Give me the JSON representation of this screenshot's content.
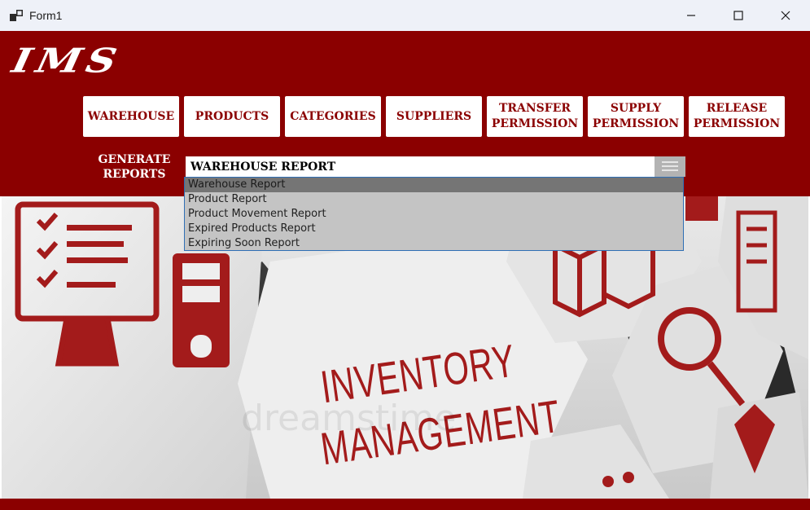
{
  "window": {
    "title": "Form1"
  },
  "app": {
    "logo": "IMS"
  },
  "nav": {
    "warehouse": "WAREHOUSE",
    "products": "PRODUCTS",
    "categories": "CATEGORIES",
    "suppliers": "SUPPLIERS",
    "transfer_permission": "TRANSFER PERMISSION",
    "supply_permission": "SUPPLY PERMISSION",
    "release_permission": "RELEASE PERMISSION"
  },
  "reports": {
    "label": "GENERATE REPORTS",
    "selected": "Warehouse Report",
    "options": [
      "Warehouse Report",
      "Product Report",
      "Product Movement Report",
      "Expired Products Report",
      "Expiring Soon Report"
    ]
  },
  "hero": {
    "line1": "INVENTORY",
    "line2": "MANAGEMENT",
    "watermark": "dreamstime"
  },
  "colors": {
    "brand": "#8b0000",
    "titlebar": "#eef1f8",
    "dropdown": "#c4c4c4",
    "selected_option": "#757575"
  },
  "icons": [
    "app-icon",
    "minimize-icon",
    "maximize-icon",
    "close-icon",
    "dropdown-arrow-icon"
  ]
}
